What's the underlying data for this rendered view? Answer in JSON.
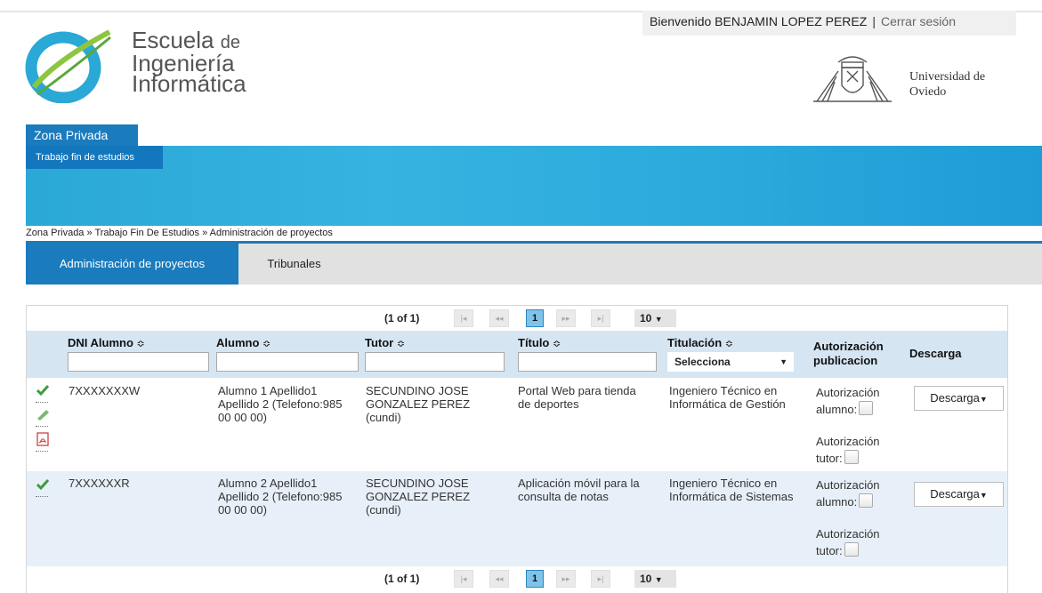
{
  "header": {
    "welcome_text": "Bienvenido BENJAMIN LOPEZ PEREZ",
    "separator": "|",
    "logout_label": "Cerrar sesión",
    "logo_line1": "Escuela",
    "logo_line1_suffix": "de",
    "logo_line2": "Ingeniería",
    "logo_line3": "Informática",
    "university_line1": "Universidad de",
    "university_line2": "Oviedo"
  },
  "nav": {
    "zone_tab": "Zona Privada",
    "sub_tab": "Trabajo fin de estudios",
    "breadcrumb": "Zona Privada » Trabajo Fin De Estudios » Administración de proyectos"
  },
  "tabs": [
    {
      "label": "Administración de proyectos",
      "active": true
    },
    {
      "label": "Tribunales",
      "active": false
    }
  ],
  "pager": {
    "count": "(1 of 1)",
    "page": "1",
    "rows_per_page": "10",
    "first": "|◂",
    "prev": "◂◂",
    "next": "▸▸",
    "last": "▸|"
  },
  "table": {
    "columns": {
      "dni": "DNI Alumno",
      "alumno": "Alumno",
      "tutor": "Tutor",
      "titulo": "Título",
      "titulacion": "Titulación",
      "autorizacion": "Autorización publicacion",
      "descarga": "Descarga"
    },
    "sort_glyph": "≎",
    "titulacion_filter": "Selecciona",
    "rows": [
      {
        "dni": "7XXXXXXXW",
        "alumno": "Alumno 1 Apellido1 Apellido 2 (Telefono:985 00 00 00)",
        "tutor": "SECUNDINO JOSE GONZALEZ PEREZ (cundi)",
        "titulo": "Portal Web para tienda de deportes",
        "titulacion": "Ingeniero Técnico en Informática de Gestión",
        "auth_alumno": "Autorización alumno:",
        "auth_tutor": "Autorización tutor:",
        "download": "Descarga"
      },
      {
        "dni": "7XXXXXXR",
        "alumno": "Alumno 2 Apellido1 Apellido 2 (Telefono:985 00 00 00)",
        "tutor": "SECUNDINO JOSE GONZALEZ PEREZ (cundi)",
        "titulo": "Aplicación móvil para la consulta de notas",
        "titulacion": "Ingeniero Técnico en Informática de Sistemas",
        "auth_alumno": "Autorización alumno:",
        "auth_tutor": "Autorización tutor:",
        "download": "Descarga"
      }
    ]
  },
  "colors": {
    "primary_blue": "#1a7bbd",
    "banner": "#36b3e0",
    "header_row": "#d5e5f2",
    "row_alt": "#e7f0f8"
  }
}
